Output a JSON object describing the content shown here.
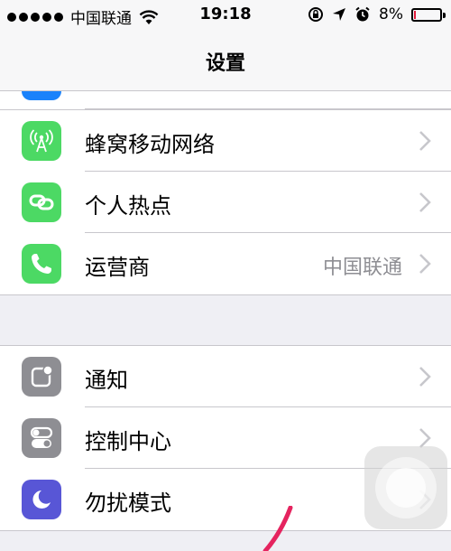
{
  "status_bar": {
    "carrier": "中国联通",
    "time": "19:18",
    "battery_percent": "8%",
    "battery_level": 0.08,
    "battery_color": "#e21b3c",
    "icons": [
      "signal-dots-icon",
      "wifi-icon",
      "rotation-lock-icon",
      "location-icon",
      "alarm-icon",
      "battery-icon"
    ]
  },
  "nav": {
    "title": "设置"
  },
  "group1": [
    {
      "label": "蜂窝移动网络",
      "detail": "",
      "icon": "cellular-icon",
      "color": "#4cd964"
    },
    {
      "label": "个人热点",
      "detail": "",
      "icon": "hotspot-icon",
      "color": "#4cd964"
    },
    {
      "label": "运营商",
      "detail": "中国联通",
      "icon": "phone-icon",
      "color": "#4cd964"
    }
  ],
  "group2": [
    {
      "label": "通知",
      "detail": "",
      "icon": "notifications-icon",
      "color": "#8e8e93"
    },
    {
      "label": "控制中心",
      "detail": "",
      "icon": "control-center-icon",
      "color": "#8e8e93"
    },
    {
      "label": "勿扰模式",
      "detail": "",
      "icon": "do-not-disturb-icon",
      "color": "#5856d6"
    }
  ]
}
